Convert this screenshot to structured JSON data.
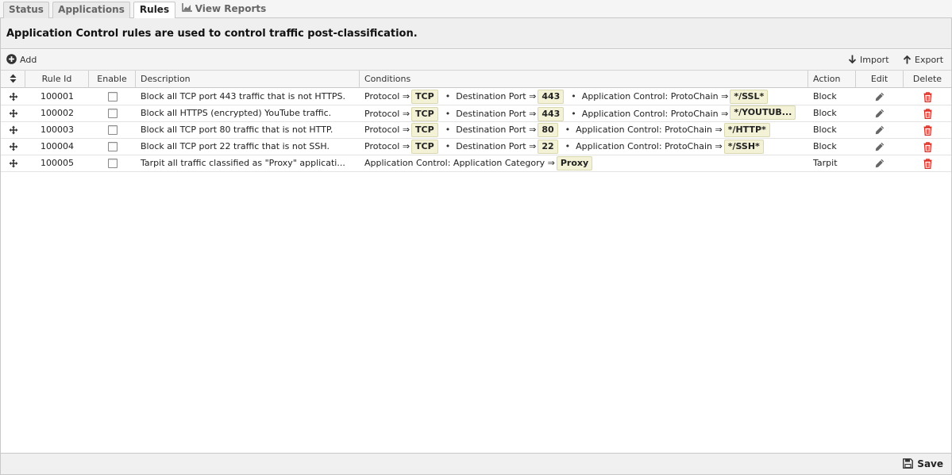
{
  "tabs": [
    {
      "label": "Status"
    },
    {
      "label": "Applications"
    },
    {
      "label": "Rules"
    },
    {
      "label": "View Reports"
    }
  ],
  "banner": {
    "text": "Application Control rules are used to control traffic post-classification."
  },
  "toolbar": {
    "add_label": "Add",
    "import_label": "Import",
    "export_label": "Export"
  },
  "columns": {
    "rule_id": "Rule Id",
    "enable": "Enable",
    "description": "Description",
    "conditions": "Conditions",
    "action": "Action",
    "edit": "Edit",
    "delete": "Delete"
  },
  "rules": [
    {
      "id": "100001",
      "description": "Block all TCP port 443 traffic that is not HTTPS.",
      "conditions": [
        {
          "label": "Protocol ⇒",
          "value": "TCP"
        },
        {
          "label": "Destination Port ⇒",
          "value": "443"
        },
        {
          "label": "Application Control: ProtoChain ⇒",
          "value": "*/SSL*"
        }
      ],
      "action": "Block"
    },
    {
      "id": "100002",
      "description": "Block all HTTPS (encrypted) YouTube traffic.",
      "conditions": [
        {
          "label": "Protocol ⇒",
          "value": "TCP"
        },
        {
          "label": "Destination Port ⇒",
          "value": "443"
        },
        {
          "label": "Application Control: ProtoChain ⇒",
          "value": "*/YOUTUB..."
        }
      ],
      "action": "Block"
    },
    {
      "id": "100003",
      "description": "Block all TCP port 80 traffic that is not HTTP.",
      "conditions": [
        {
          "label": "Protocol ⇒",
          "value": "TCP"
        },
        {
          "label": "Destination Port ⇒",
          "value": "80"
        },
        {
          "label": "Application Control: ProtoChain ⇒",
          "value": "*/HTTP*"
        }
      ],
      "action": "Block"
    },
    {
      "id": "100004",
      "description": "Block all TCP port 22 traffic that is not SSH.",
      "conditions": [
        {
          "label": "Protocol ⇒",
          "value": "TCP"
        },
        {
          "label": "Destination Port ⇒",
          "value": "22"
        },
        {
          "label": "Application Control: ProtoChain ⇒",
          "value": "*/SSH*"
        }
      ],
      "action": "Block"
    },
    {
      "id": "100005",
      "description": "Tarpit all traffic classified as \"Proxy\" applicati...",
      "conditions": [
        {
          "label": "Application Control: Application Category ⇒",
          "value": "Proxy"
        }
      ],
      "action": "Tarpit"
    }
  ],
  "footer": {
    "save_label": "Save"
  },
  "icons": {
    "tab_reports": "chart-icon",
    "add": "plus-circle-icon",
    "import": "arrow-down-icon",
    "export": "arrow-up-icon",
    "sort": "sort-icon",
    "drag": "move-icon",
    "edit": "pencil-icon",
    "delete": "trash-icon",
    "save": "floppy-disk-icon"
  },
  "colors": {
    "delete_icon": "#d9261c",
    "condition_tag_bg": "#f3f2d7"
  }
}
